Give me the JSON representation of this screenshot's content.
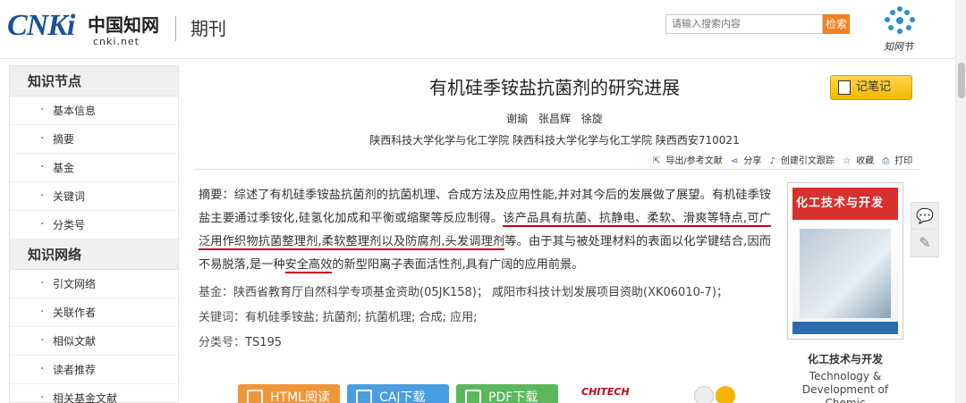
{
  "header": {
    "logo_main": "CNKi",
    "logo_cn": "中国知网",
    "logo_sub": "cnki.net",
    "section": "期刊",
    "search_placeholder": "请输入搜索内容",
    "search_button": "检索",
    "zwh_label": "知网节"
  },
  "sidebar": {
    "section1": "知识节点",
    "items1": [
      "基本信息",
      "摘要",
      "基金",
      "关键词",
      "分类号"
    ],
    "section2": "知识网络",
    "items2": [
      "引文网络",
      "关联作者",
      "相似文献",
      "读者推荐",
      "相关基金文献"
    ]
  },
  "article": {
    "title": "有机硅季铵盐抗菌剂的研究进展",
    "note_button": "记笔记",
    "authors": "谢瑜 张昌辉 徐旋",
    "org": "陕西科技大学化学与化工学院 陕西科技大学化学与化工学院 陕西西安710021",
    "tools": {
      "export": "导出/参考文献",
      "share": "分享",
      "track": "创建引文跟踪",
      "favorite": "收藏",
      "print": "打印"
    },
    "abstract_label": "摘要：",
    "abstract_p1": "综述了有机硅季铵盐抗菌剂的抗菌机理、合成方法及应用性能,并对其今后的发展做了展望。有机硅季铵盐主要通过季铵化,硅氢化加成和平衡或缩聚等反应制得。",
    "abstract_hl1": "该产品具有抗菌、抗静电、柔软、滑爽等特点,可广泛用作织物抗菌整理剂,柔软整理剂以及防腐剂,头发调理剂",
    "abstract_p2": "等。由于其与被处理材料的表面以化学键结合,因而不易脱落,是一种",
    "abstract_hl2": "安全高效",
    "abstract_p3": "的新型阳离子表面活性剂,具有广阔的应用前景。",
    "fund_label": "基金：",
    "fund": "陕西省教育厅自然科学专项基金资助(05JK158)； 咸阳市科技计划发展项目资助(XK06010-7)；",
    "keywords_label": "关键词：",
    "keywords": "有机硅季铵盐; 抗菌剂; 抗菌机理; 合成; 应用;",
    "class_label": "分类号：",
    "class": "TS195"
  },
  "journal": {
    "cover_title": "化工技术与开发",
    "name": "化工技术与开发",
    "en": "Technology & Development of Chemic"
  },
  "downloads": {
    "html": "HTML阅读",
    "caj": "CAJ下载",
    "pdf": "PDF下载",
    "badge": "CHITECH"
  },
  "colors": {
    "accent_blue": "#1a4f9c",
    "search_orange": "#f2801f",
    "note_yellow": "#f2b800",
    "underline_red": "#c8001a",
    "html_btn": "#f0963a",
    "caj_btn": "#4a9de0",
    "pdf_btn": "#5bb85d"
  }
}
